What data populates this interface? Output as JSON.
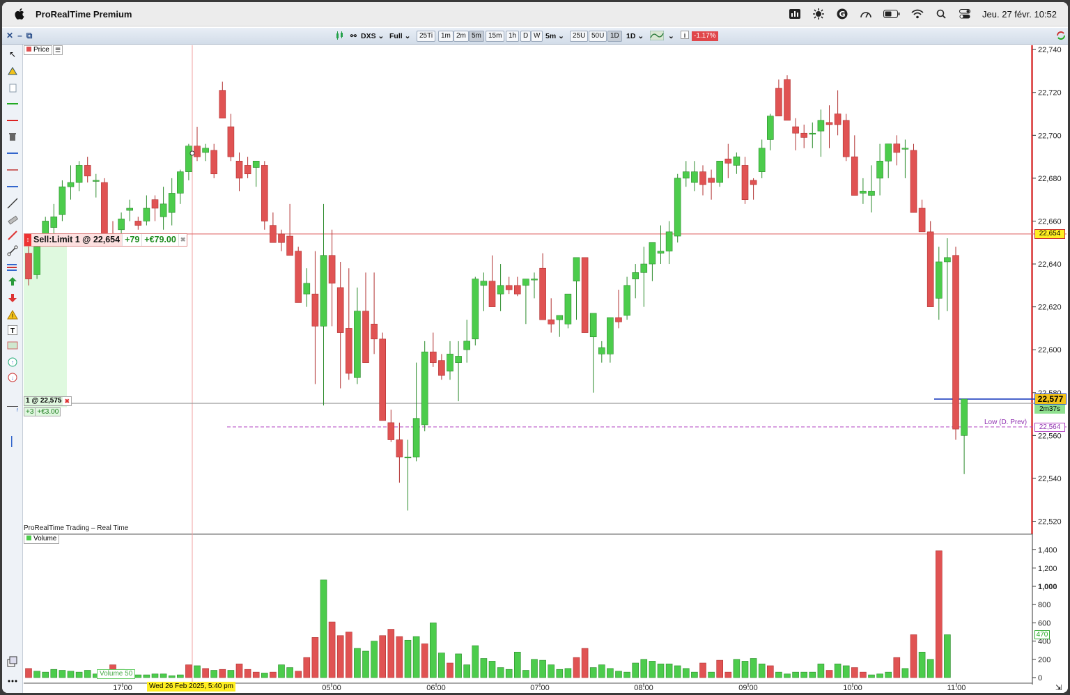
{
  "menubar": {
    "app_name": "ProRealTime Premium",
    "clock": "Jeu. 27 févr.  10:52",
    "icons": [
      "apple-icon",
      "app-status-icon",
      "sun-icon",
      "grammarly-icon",
      "speedometer-icon",
      "battery-icon",
      "wifi-icon",
      "search-icon",
      "control-center-icon"
    ]
  },
  "toolbar": {
    "instrument": "DXS",
    "mode": "Full",
    "intervals": [
      "25Ti",
      "1m",
      "2m",
      "5m",
      "15m",
      "1h",
      "D",
      "W"
    ],
    "active_interval": "5m",
    "interval_select": "5m",
    "units": [
      "25U",
      "50U",
      "1D"
    ],
    "active_unit": "1D",
    "period_select": "1D",
    "change": "-1.17%"
  },
  "panels": {
    "price_label": "Price",
    "volume_label": "Volume",
    "feed_label": "ProRealTime Trading – Real Time"
  },
  "orders": {
    "sell_limit": "Sell:Limit 1 @ 22,654",
    "sell_points": "+79",
    "sell_profit": "+€79.00",
    "position": "1 @ 22,575",
    "position_points": "+3",
    "position_profit": "+€3.00"
  },
  "markers": {
    "limit_price": "22,654",
    "last_price": "22,577",
    "countdown": "2m37s",
    "low_prev_label": "Low (D. Prev)",
    "low_prev_price": "22,564",
    "volume_last": "470",
    "volume_ma_label": "Volume   50",
    "cursor_date": "Wed 26 Feb 2025, 5:40 pm"
  },
  "chart_data": [
    {
      "type": "candlestick",
      "panel": "price",
      "y_ticks": [
        "22,740",
        "22,720",
        "22,700",
        "22,680",
        "22,660",
        "22,640",
        "22,620",
        "22,600",
        "22,580",
        "22,560",
        "22,540",
        "22,520"
      ],
      "ylim": [
        22514,
        22742
      ],
      "x_ticks": [
        "17:00",
        "05:00",
        "06:00",
        "07:00",
        "08:00",
        "09:00",
        "10:00",
        "11:00"
      ],
      "levels": {
        "sell_limit": 22654,
        "position": 22575,
        "last": 22577,
        "low_prev_day": 22564
      },
      "ohlc": [
        [
          22645,
          22652,
          22630,
          22633
        ],
        [
          22635,
          22650,
          22633,
          22648
        ],
        [
          22652,
          22662,
          22650,
          22660
        ],
        [
          22657,
          22668,
          22654,
          22662
        ],
        [
          22663,
          22679,
          22660,
          22676
        ],
        [
          22676,
          22686,
          22670,
          22678
        ],
        [
          22678,
          22688,
          22674,
          22686
        ],
        [
          22686,
          22690,
          22678,
          22681
        ],
        [
          22679,
          22682,
          22671,
          22679
        ],
        [
          22678,
          22680,
          22650,
          22652
        ],
        [
          22654,
          22660,
          22649,
          22651
        ],
        [
          22656,
          22664,
          22654,
          22661
        ],
        [
          22665,
          22670,
          22660,
          22666
        ],
        [
          22660,
          22662,
          22656,
          22658
        ],
        [
          22660,
          22672,
          22658,
          22666
        ],
        [
          22670,
          22672,
          22660,
          22666
        ],
        [
          22662,
          22676,
          22656,
          22668
        ],
        [
          22664,
          22680,
          22658,
          22673
        ],
        [
          22673,
          22684,
          22668,
          22683
        ],
        [
          22683,
          22696,
          22679,
          22695
        ],
        [
          22695,
          22704,
          22688,
          22690
        ],
        [
          22692,
          22696,
          22688,
          22694
        ],
        [
          22693,
          22696,
          22680,
          22682
        ],
        [
          22721,
          22725,
          22710,
          22708
        ],
        [
          22704,
          22710,
          22688,
          22690
        ],
        [
          22688,
          22692,
          22674,
          22680
        ],
        [
          22686,
          22690,
          22680,
          22682
        ],
        [
          22685,
          22688,
          22676,
          22688
        ],
        [
          22686,
          22688,
          22656,
          22660
        ],
        [
          22658,
          22664,
          22650,
          22650
        ],
        [
          22654,
          22656,
          22646,
          22650
        ],
        [
          22653,
          22668,
          22644,
          22644
        ],
        [
          22646,
          22648,
          22622,
          22622
        ],
        [
          22626,
          22638,
          22620,
          22631
        ],
        [
          22626,
          22646,
          22584,
          22611
        ],
        [
          22611,
          22668,
          22574,
          22644
        ],
        [
          22644,
          22656,
          22611,
          22631
        ],
        [
          22629,
          22641,
          22582,
          22608
        ],
        [
          22610,
          22638,
          22586,
          22589
        ],
        [
          22587,
          22629,
          22584,
          22618
        ],
        [
          22618,
          22636,
          22594,
          22594
        ],
        [
          22612,
          22636,
          22598,
          22605
        ],
        [
          22605,
          22608,
          22580,
          22567
        ],
        [
          22566,
          22572,
          22557,
          22558
        ],
        [
          22558,
          22566,
          22538,
          22550
        ],
        [
          22550,
          22558,
          22525,
          22550
        ],
        [
          22550,
          22594,
          22548,
          22568
        ],
        [
          22565,
          22604,
          22562,
          22599
        ],
        [
          22599,
          22608,
          22592,
          22594
        ],
        [
          22595,
          22598,
          22586,
          22588
        ],
        [
          22590,
          22604,
          22586,
          22598
        ],
        [
          22594,
          22604,
          22576,
          22597
        ],
        [
          22600,
          22614,
          22594,
          22604
        ],
        [
          22605,
          22634,
          22602,
          22633
        ],
        [
          22630,
          22636,
          22618,
          22632
        ],
        [
          22632,
          22644,
          22621,
          22620
        ],
        [
          22626,
          22640,
          22618,
          22630
        ],
        [
          22630,
          22634,
          22626,
          22628
        ],
        [
          22630,
          22634,
          22625,
          22626
        ],
        [
          22630,
          22632,
          22612,
          22633
        ],
        [
          22633,
          22636,
          22624,
          22633
        ],
        [
          22638,
          22645,
          22614,
          22614
        ],
        [
          22614,
          22624,
          22608,
          22612
        ],
        [
          22614,
          22616,
          22606,
          22616
        ],
        [
          22612,
          22626,
          22610,
          22626
        ],
        [
          22632,
          22640,
          22614,
          22643
        ],
        [
          22643,
          22643,
          22608,
          22608
        ],
        [
          22606,
          22612,
          22580,
          22617
        ],
        [
          22598,
          22604,
          22594,
          22601
        ],
        [
          22598,
          22614,
          22594,
          22615
        ],
        [
          22615,
          22628,
          22610,
          22613
        ],
        [
          22616,
          22634,
          22614,
          22630
        ],
        [
          22633,
          22640,
          22624,
          22636
        ],
        [
          22636,
          22648,
          22620,
          22640
        ],
        [
          22640,
          22650,
          22632,
          22650
        ],
        [
          22645,
          22658,
          22640,
          22646
        ],
        [
          22646,
          22660,
          22640,
          22655
        ],
        [
          22653,
          22682,
          22650,
          22680
        ],
        [
          22680,
          22688,
          22676,
          22683
        ],
        [
          22678,
          22688,
          22674,
          22683
        ],
        [
          22683,
          22686,
          22672,
          22677
        ],
        [
          22680,
          22684,
          22670,
          22678
        ],
        [
          22678,
          22688,
          22676,
          22688
        ],
        [
          22689,
          22696,
          22680,
          22687
        ],
        [
          22686,
          22692,
          22682,
          22690
        ],
        [
          22686,
          22690,
          22668,
          22670
        ],
        [
          22679,
          22680,
          22670,
          22677
        ],
        [
          22683,
          22698,
          22680,
          22694
        ],
        [
          22698,
          22710,
          22693,
          22709
        ],
        [
          22722,
          22726,
          22709,
          22709
        ],
        [
          22726,
          22728,
          22707,
          22707
        ],
        [
          22704,
          22708,
          22693,
          22701
        ],
        [
          22701,
          22705,
          22694,
          22699
        ],
        [
          22701,
          22706,
          22694,
          22701
        ],
        [
          22702,
          22712,
          22690,
          22707
        ],
        [
          22706,
          22714,
          22694,
          22705
        ],
        [
          22710,
          22721,
          22700,
          22705
        ],
        [
          22707,
          22710,
          22688,
          22690
        ],
        [
          22690,
          22700,
          22672,
          22672
        ],
        [
          22673,
          22680,
          22668,
          22674
        ],
        [
          22672,
          22686,
          22664,
          22674
        ],
        [
          22680,
          22696,
          22672,
          22688
        ],
        [
          22688,
          22696,
          22680,
          22696
        ],
        [
          22696,
          22700,
          22686,
          22692
        ],
        [
          22694,
          22698,
          22680,
          22694
        ],
        [
          22693,
          22696,
          22664,
          22664
        ],
        [
          22666,
          22670,
          22656,
          22655
        ],
        [
          22655,
          22660,
          22638,
          22620
        ],
        [
          22624,
          22648,
          22614,
          22641
        ],
        [
          22641,
          22652,
          22618,
          22643
        ],
        [
          22644,
          22648,
          22558,
          22563
        ],
        [
          22560,
          22576,
          22542,
          22577
        ]
      ]
    },
    {
      "type": "bar",
      "panel": "volume",
      "y_ticks": [
        "1,400",
        "1,200",
        "1,000",
        "800",
        "600",
        "400",
        "200",
        "0"
      ],
      "ylim": [
        0,
        1450
      ],
      "values": [
        [
          100,
          "red"
        ],
        [
          70,
          "green"
        ],
        [
          60,
          "green"
        ],
        [
          90,
          "green"
        ],
        [
          80,
          "green"
        ],
        [
          70,
          "green"
        ],
        [
          60,
          "green"
        ],
        [
          80,
          "green"
        ],
        [
          40,
          "green"
        ],
        [
          60,
          "green"
        ],
        [
          140,
          "red"
        ],
        [
          90,
          "green"
        ],
        [
          40,
          "green"
        ],
        [
          30,
          "green"
        ],
        [
          30,
          "green"
        ],
        [
          40,
          "green"
        ],
        [
          40,
          "green"
        ],
        [
          20,
          "green"
        ],
        [
          30,
          "green"
        ],
        [
          140,
          "red"
        ],
        [
          130,
          "green"
        ],
        [
          100,
          "red"
        ],
        [
          80,
          "green"
        ],
        [
          90,
          "red"
        ],
        [
          80,
          "green"
        ],
        [
          150,
          "red"
        ],
        [
          90,
          "red"
        ],
        [
          60,
          "red"
        ],
        [
          50,
          "green"
        ],
        [
          60,
          "red"
        ],
        [
          140,
          "green"
        ],
        [
          110,
          "green"
        ],
        [
          70,
          "red"
        ],
        [
          220,
          "red"
        ],
        [
          440,
          "red"
        ],
        [
          1070,
          "green"
        ],
        [
          610,
          "red"
        ],
        [
          460,
          "red"
        ],
        [
          500,
          "red"
        ],
        [
          320,
          "green"
        ],
        [
          290,
          "green"
        ],
        [
          400,
          "green"
        ],
        [
          460,
          "red"
        ],
        [
          530,
          "red"
        ],
        [
          450,
          "red"
        ],
        [
          410,
          "green"
        ],
        [
          450,
          "green"
        ],
        [
          370,
          "red"
        ],
        [
          600,
          "green"
        ],
        [
          270,
          "green"
        ],
        [
          160,
          "red"
        ],
        [
          260,
          "green"
        ],
        [
          140,
          "green"
        ],
        [
          350,
          "green"
        ],
        [
          210,
          "green"
        ],
        [
          180,
          "green"
        ],
        [
          110,
          "green"
        ],
        [
          90,
          "green"
        ],
        [
          280,
          "green"
        ],
        [
          80,
          "green"
        ],
        [
          200,
          "green"
        ],
        [
          190,
          "green"
        ],
        [
          140,
          "green"
        ],
        [
          90,
          "green"
        ],
        [
          100,
          "green"
        ],
        [
          220,
          "red"
        ],
        [
          320,
          "red"
        ],
        [
          110,
          "green"
        ],
        [
          140,
          "green"
        ],
        [
          100,
          "green"
        ],
        [
          70,
          "green"
        ],
        [
          60,
          "green"
        ],
        [
          160,
          "green"
        ],
        [
          200,
          "green"
        ],
        [
          180,
          "green"
        ],
        [
          150,
          "green"
        ],
        [
          150,
          "green"
        ],
        [
          130,
          "green"
        ],
        [
          100,
          "green"
        ],
        [
          60,
          "green"
        ],
        [
          160,
          "red"
        ],
        [
          60,
          "green"
        ],
        [
          190,
          "red"
        ],
        [
          60,
          "red"
        ],
        [
          200,
          "green"
        ],
        [
          180,
          "green"
        ],
        [
          210,
          "green"
        ],
        [
          150,
          "green"
        ],
        [
          130,
          "red"
        ],
        [
          60,
          "green"
        ],
        [
          40,
          "green"
        ],
        [
          60,
          "green"
        ],
        [
          60,
          "green"
        ],
        [
          60,
          "green"
        ],
        [
          150,
          "green"
        ],
        [
          80,
          "red"
        ],
        [
          150,
          "green"
        ],
        [
          130,
          "green"
        ],
        [
          110,
          "red"
        ],
        [
          60,
          "red"
        ],
        [
          30,
          "green"
        ],
        [
          40,
          "green"
        ],
        [
          60,
          "green"
        ],
        [
          220,
          "red"
        ],
        [
          100,
          "green"
        ],
        [
          470,
          "red"
        ],
        [
          280,
          "green"
        ],
        [
          200,
          "green"
        ],
        [
          1390,
          "red"
        ],
        [
          470,
          "green"
        ]
      ]
    }
  ]
}
